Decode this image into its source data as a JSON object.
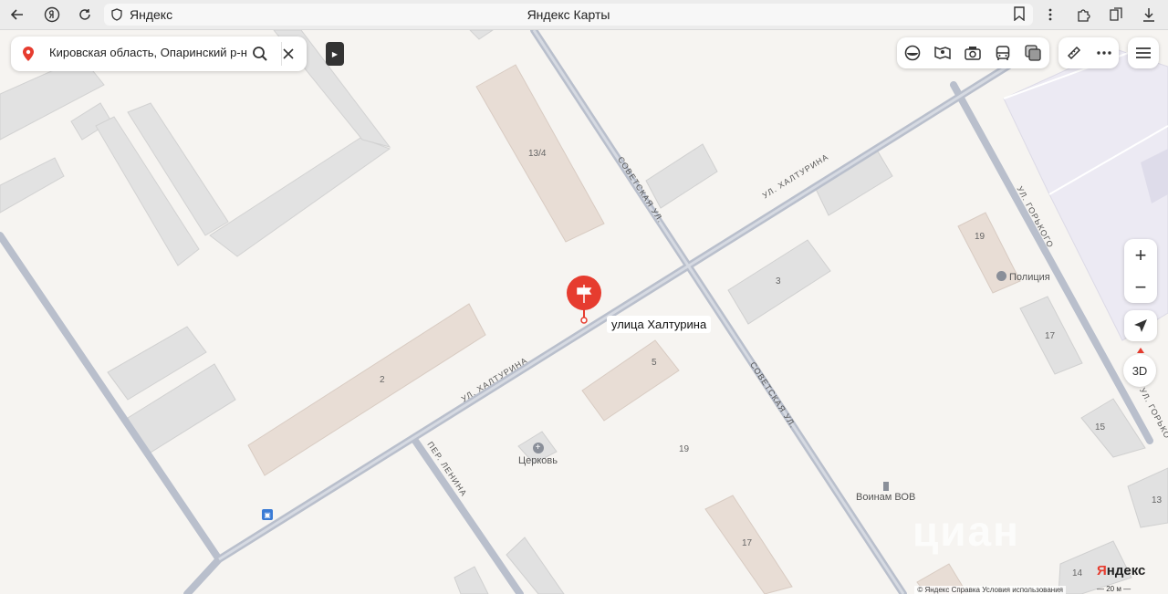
{
  "browser": {
    "host": "Яндекс",
    "page_title": "Яндекс Карты"
  },
  "search": {
    "value": "Кировская область, Опаринский р-н,"
  },
  "map": {
    "buildings": {
      "b13_4": "13/4",
      "b2": "2",
      "b3": "3",
      "b5": "5",
      "b19a": "19",
      "b19b": "19",
      "b17a": "17",
      "b17b": "17",
      "b15": "15",
      "b13": "13",
      "b14": "14"
    },
    "streets": {
      "khalturina_1": "ул. Халтурина",
      "khalturina_2": "ул. Халтурина",
      "sovetskaya_1": "Советская ул.",
      "sovetskaya_2": "Советская ул.",
      "gorkogo_1": "ул. Горького",
      "gorkogo_2": "ул. Горько",
      "lenina": "пер. Ленина"
    },
    "pois": {
      "police": "Полиция",
      "church": "Церковь",
      "memorial": "Воинам ВОВ"
    },
    "marker_label": "улица Халтурина",
    "watermark": "циан"
  },
  "controls": {
    "zoom_in": "+",
    "zoom_out": "−",
    "three_d": "3D"
  },
  "footer": {
    "copyright": "© Яндекс  Справка  Условия использования",
    "brand_y": "Я",
    "brand_rest": "ндекс",
    "scale": "20 м"
  }
}
